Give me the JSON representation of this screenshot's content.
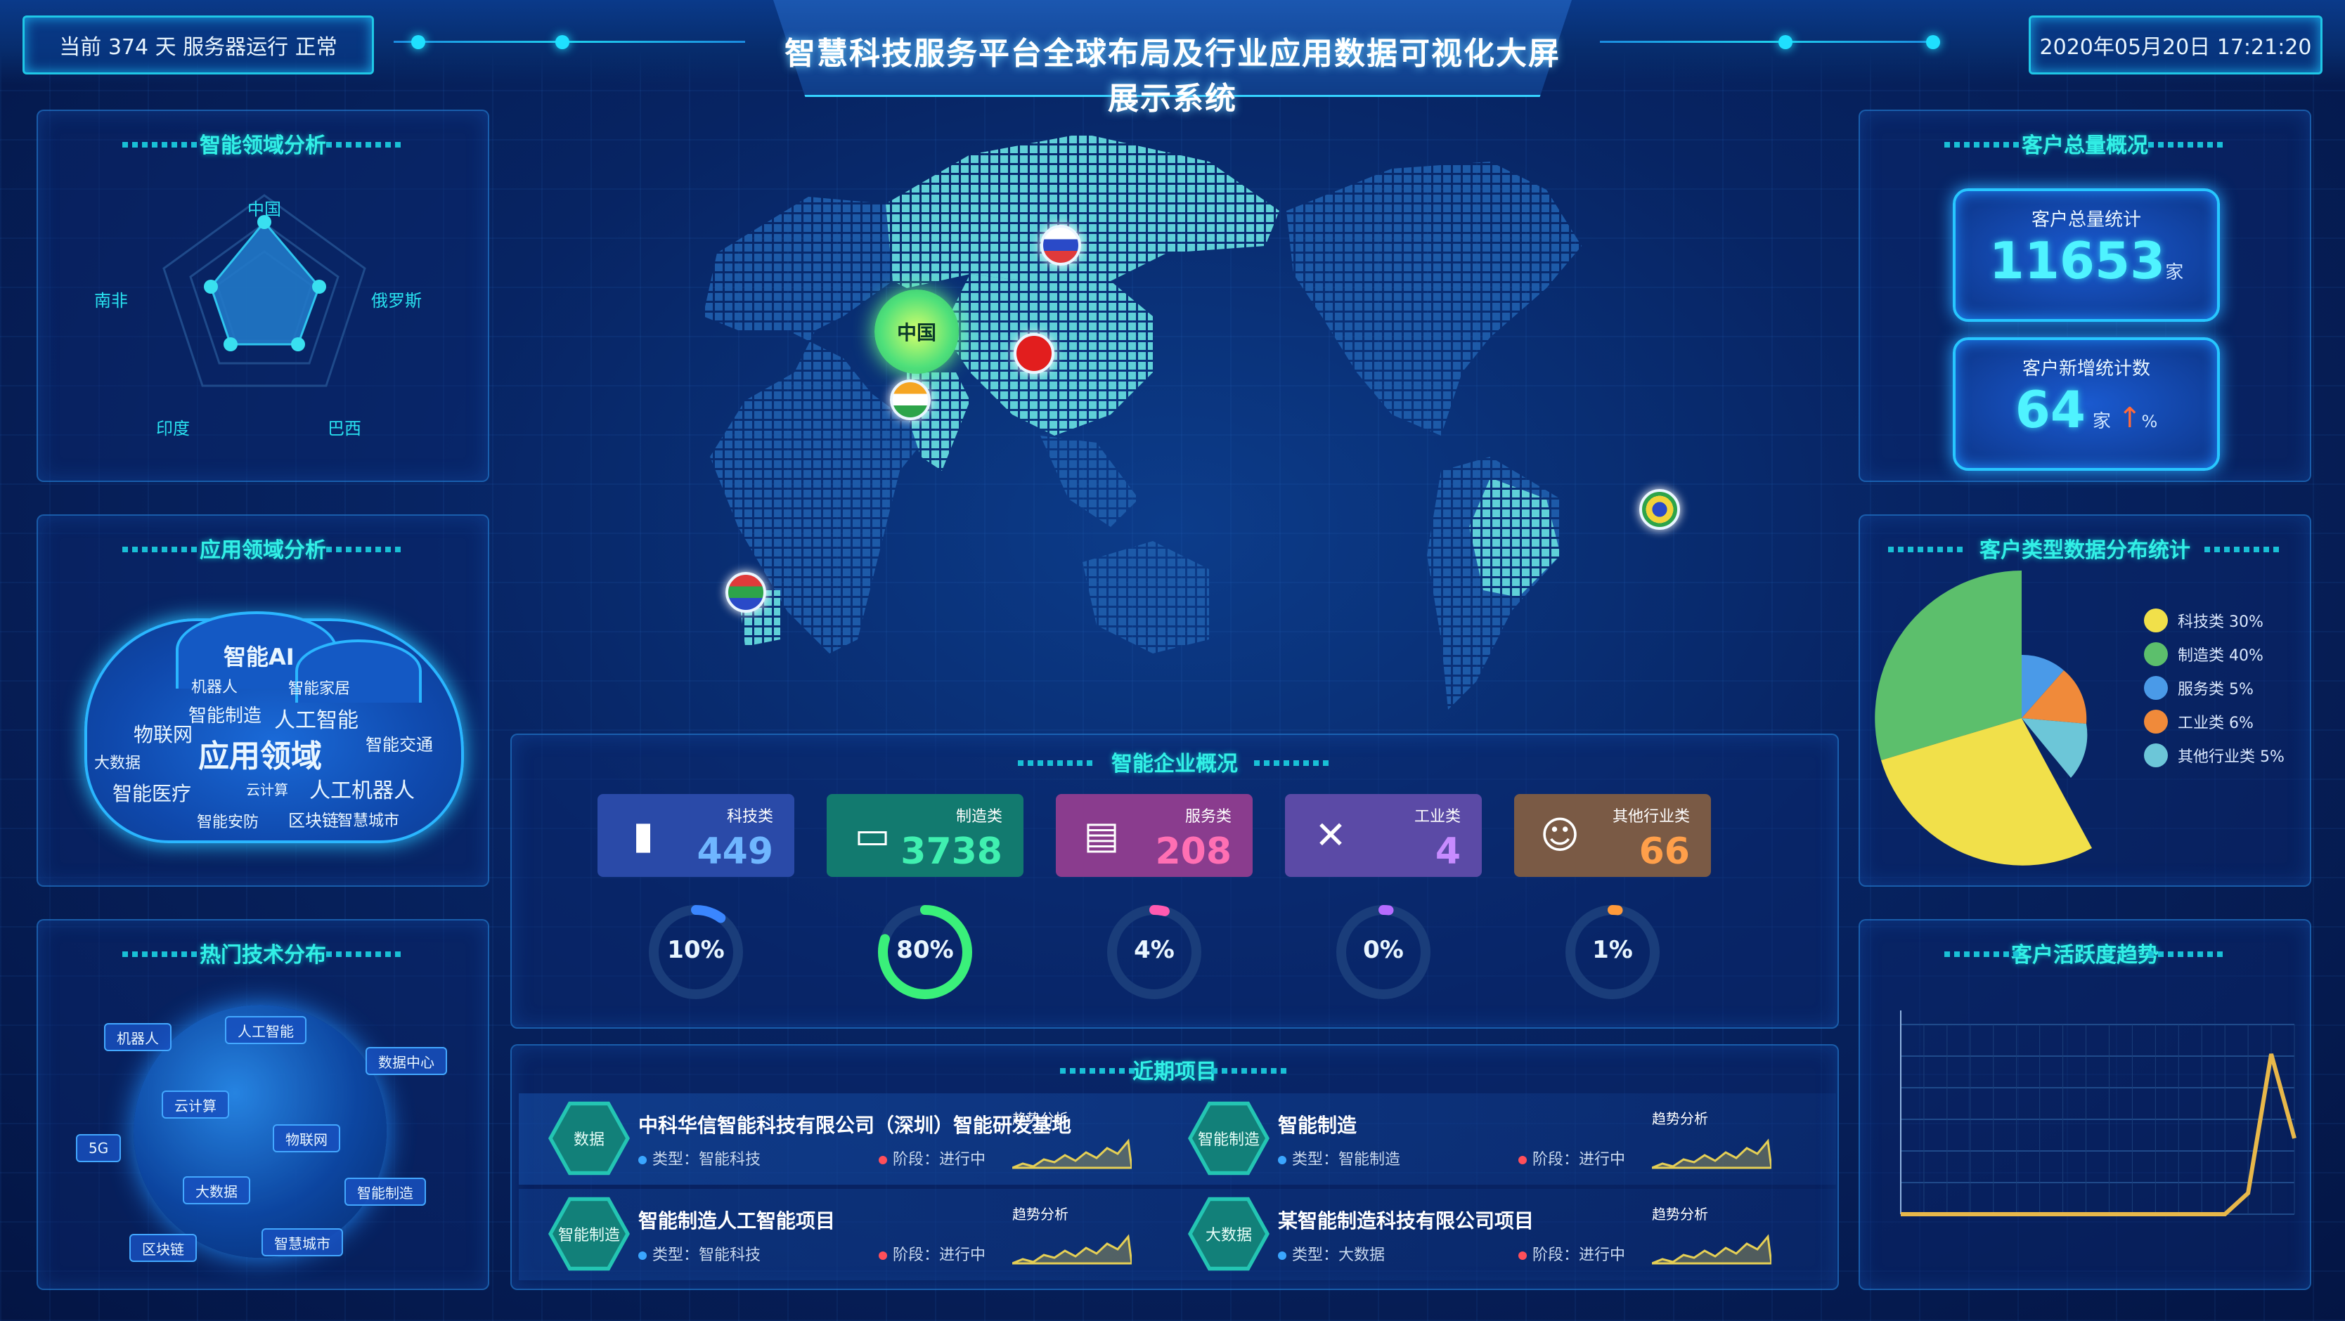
{
  "header": {
    "left_text": "当前 374 天 服务器运行 正常",
    "title": "智慧科技服务平台全球布局及行业应用数据可视化大屏展示系统",
    "right_text": "2020年05月20日 17:21:20"
  },
  "radar_panel": {
    "title": "智能领域分析",
    "subtitle": "",
    "labels": [
      "中国",
      "俄罗斯",
      "巴西",
      "印度",
      "南非"
    ]
  },
  "cloud_panel": {
    "title": "应用领域分析",
    "words": [
      "智能AI",
      "机器人",
      "智能家居",
      "智能制造",
      "物联网",
      "人工智能",
      "应用领域",
      "智能医疗",
      "智能交通",
      "大数据",
      "人工机器人",
      "云计算",
      "智能安防",
      "区块链",
      "智慧城市"
    ]
  },
  "globe_panel": {
    "title": "热门技术分布",
    "tags": [
      "机器人",
      "人工智能",
      "数据中心",
      "云计算",
      "5G",
      "物联网",
      "大数据",
      "智能制造",
      "区块链",
      "智慧城市"
    ]
  },
  "map": {
    "center_label": "中国",
    "markers": [
      {
        "name": "俄罗斯",
        "color": "#e03a3a"
      },
      {
        "name": "中国",
        "color": "#e21e1e"
      },
      {
        "name": "印度",
        "color": "#f5a523"
      },
      {
        "name": "巴西",
        "color": "#2da44a"
      },
      {
        "name": "南非",
        "color": "#2da44a"
      }
    ]
  },
  "stats": {
    "title": "智能企业概况",
    "cards": [
      {
        "label": "科技类",
        "value": "449",
        "bg": "#2a4aa8",
        "color": "#6fb6ff",
        "icon": "building-icon"
      },
      {
        "label": "制造类",
        "value": "3738",
        "bg": "#127a6f",
        "color": "#40f0b0",
        "icon": "factory-icon"
      },
      {
        "label": "服务类",
        "value": "208",
        "bg": "#8a3c8e",
        "color": "#ff6fb3",
        "icon": "service-icon"
      },
      {
        "label": "工业类",
        "value": "4",
        "bg": "#5b4aa6",
        "color": "#c78bff",
        "icon": "tools-icon"
      },
      {
        "label": "其他行业类",
        "value": "66",
        "bg": "#7a5a45",
        "color": "#ff9f4a",
        "icon": "people-icon"
      }
    ],
    "rings": [
      {
        "label": "10%",
        "pct": 0.1,
        "color": "#3a86ff"
      },
      {
        "label": "80%",
        "pct": 0.8,
        "color": "#3af07a"
      },
      {
        "label": "4%",
        "pct": 0.04,
        "color": "#ff5ab0"
      },
      {
        "label": "0%",
        "pct": 0.0,
        "color": "#b56bff"
      },
      {
        "label": "1%",
        "pct": 0.01,
        "color": "#ff9a3a"
      }
    ]
  },
  "projects": {
    "title": "近期项目",
    "trend_label": "趋势分析",
    "items": [
      {
        "icon": "数据",
        "title": "中科华信智能科技有限公司（深圳）智能研发基地",
        "meta1": "类型：智能科技",
        "meta2": "阶段：进行中"
      },
      {
        "icon": "智能制造",
        "title": "智能制造",
        "meta1": "类型：智能制造",
        "meta2": "阶段：进行中"
      },
      {
        "icon": "智能制造",
        "title": "智能制造人工智能项目",
        "meta1": "类型：智能科技",
        "meta2": "阶段：进行中"
      },
      {
        "icon": "大数据",
        "title": "某智能制造科技有限公司项目",
        "meta1": "类型：大数据",
        "meta2": "阶段：进行中"
      }
    ]
  },
  "right_top": {
    "title": "客户总量概况",
    "subtitle": "",
    "box1_label": "客户总量统计",
    "box1_value": "11653",
    "box1_unit": "家",
    "box2_label": "客户新增统计数",
    "box2_value": "64",
    "box2_unit": "家",
    "box2_trend": "↑",
    "box2_trend_unit": "%"
  },
  "right_mid": {
    "title": "客户类型数据分布统计",
    "legend": [
      {
        "label": "科技类 30%",
        "color": "#f1e04a"
      },
      {
        "label": "制造类 40%",
        "color": "#5cbf6c"
      },
      {
        "label": "服务类 5%",
        "color": "#4a9ae8"
      },
      {
        "label": "工业类 6%",
        "color": "#f08a3a"
      },
      {
        "label": "其他行业类 5%",
        "color": "#6cc6d8"
      }
    ]
  },
  "chart_data": {
    "type": "line",
    "title": "客户活跃度趋势",
    "x": [
      0,
      1,
      2,
      3,
      4,
      5,
      6,
      7,
      8,
      9,
      10,
      11,
      12,
      13,
      14,
      15,
      16
    ],
    "series": [
      {
        "values": [
          0,
          0,
          0,
          0,
          0,
          0,
          0,
          0,
          0,
          0,
          0,
          0,
          0,
          0,
          0,
          5,
          38,
          18
        ]
      }
    ],
    "ylim": [
      0,
      45
    ],
    "color": "#e8b84a"
  }
}
